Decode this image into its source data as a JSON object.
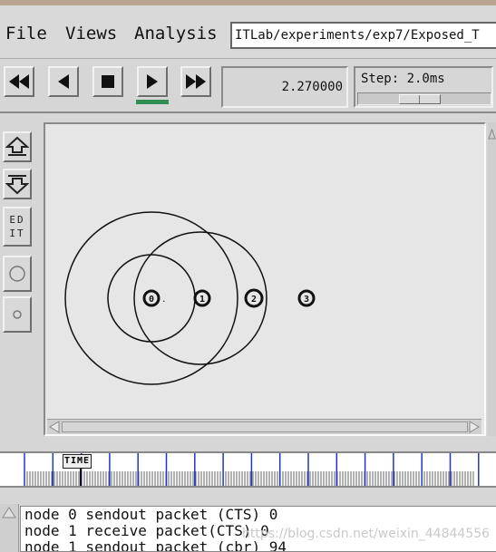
{
  "menu": {
    "file": "File",
    "views": "Views",
    "analysis": "Analysis",
    "path": "ITLab/experiments/exp7/Exposed_T"
  },
  "toolbar": {
    "buttons": [
      "rewind-icon",
      "step-back-icon",
      "stop-icon",
      "play-icon",
      "fast-forward-icon"
    ],
    "time": "2.270000",
    "step_label": "Step: 2.0ms",
    "step_slider": 0.45,
    "accent": "#2f8f52"
  },
  "leftbar": {
    "edit_label": "ED\nIT"
  },
  "canvas": {
    "nodes": [
      {
        "label": "0"
      },
      {
        "label": "1"
      },
      {
        "label": "2"
      },
      {
        "label": "3"
      }
    ]
  },
  "timeline": {
    "marker": "TIME"
  },
  "log": {
    "lines": [
      "node 0 sendout packet (CTS) 0",
      "node 1 receive packet(CTS) 0",
      "node 1 sendout packet (cbr) 94"
    ],
    "watermark": "https://blog.csdn.net/weixin_44844556"
  }
}
